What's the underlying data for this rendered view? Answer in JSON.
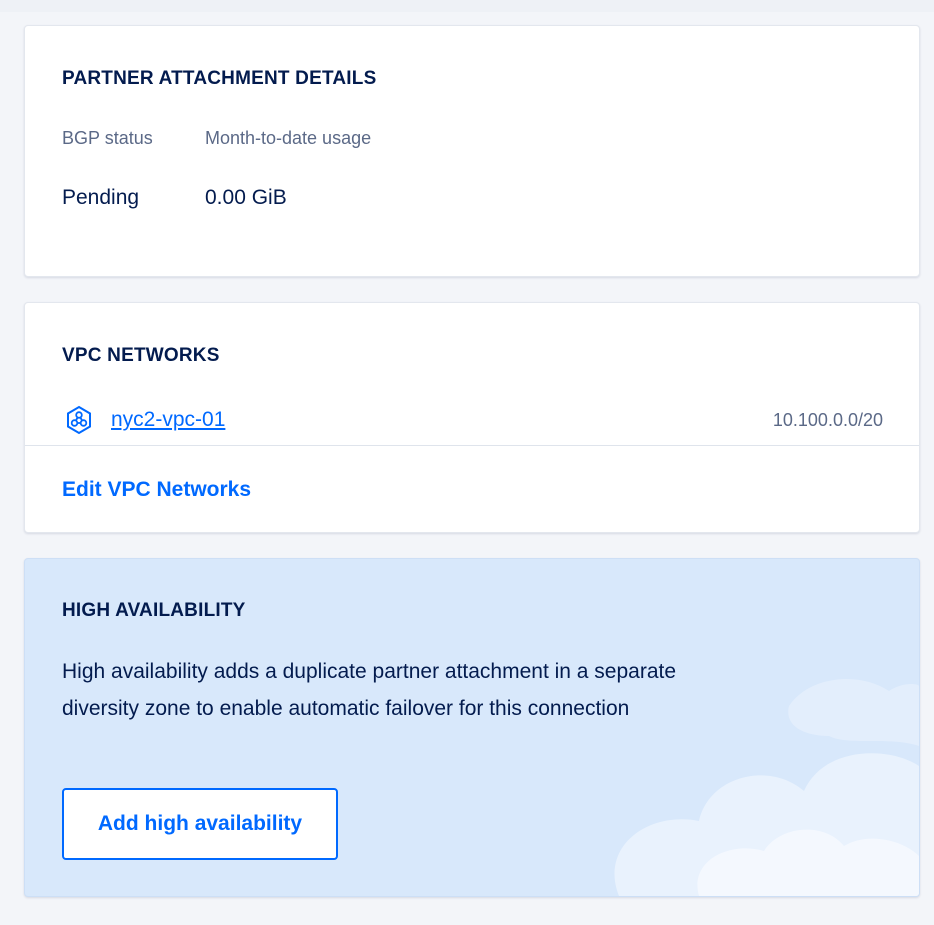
{
  "partner_attachment": {
    "title": "PARTNER ATTACHMENT DETAILS",
    "columns": [
      {
        "label": "BGP status",
        "value": "Pending"
      },
      {
        "label": "Month-to-date usage",
        "value": "0.00 GiB"
      }
    ]
  },
  "vpc_networks": {
    "title": "VPC NETWORKS",
    "items": [
      {
        "name": "nyc2-vpc-01",
        "ip_range": "10.100.0.0/20",
        "icon": "vpc-network-icon"
      }
    ],
    "edit_label": "Edit VPC Networks"
  },
  "high_availability": {
    "title": "HIGH AVAILABILITY",
    "description": "High availability adds a duplicate partner attachment in a separate diversity zone to enable automatic failover for this connection",
    "button_label": "Add high availability"
  },
  "colors": {
    "accent": "#0069ff",
    "text": "#031b4e",
    "muted": "#5b6987",
    "ha_background": "#d8e8fb"
  }
}
